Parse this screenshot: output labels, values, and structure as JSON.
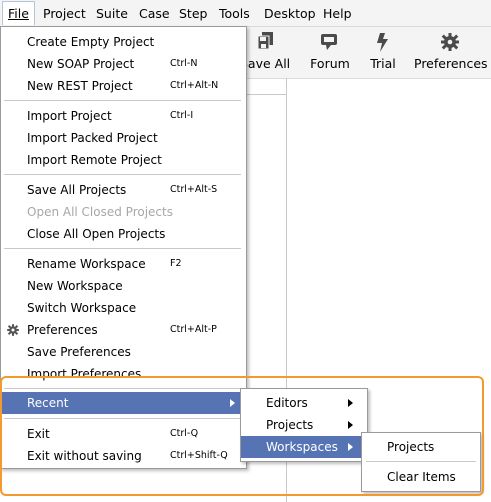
{
  "menubar": {
    "items": [
      {
        "label": "File",
        "mnemonic": "F"
      },
      {
        "label": "Project"
      },
      {
        "label": "Suite"
      },
      {
        "label": "Case"
      },
      {
        "label": "Step"
      },
      {
        "label": "Tools",
        "mnemonic": "T"
      },
      {
        "label": "Desktop",
        "mnemonic": "D"
      },
      {
        "label": "Help",
        "mnemonic": "H"
      }
    ]
  },
  "toolbar": {
    "buttons": [
      {
        "label": "Save All",
        "icon": "save-all-icon"
      },
      {
        "label": "Forum",
        "icon": "forum-icon"
      },
      {
        "label": "Trial",
        "icon": "trial-icon"
      },
      {
        "label": "Preferences",
        "icon": "gear-icon"
      }
    ]
  },
  "file_menu": {
    "items": [
      {
        "label": "Create Empty Project",
        "shortcut": ""
      },
      {
        "label": "New SOAP Project",
        "shortcut": "Ctrl-N"
      },
      {
        "label": "New REST Project",
        "shortcut": "Ctrl+Alt-N"
      },
      {
        "label": "Import Project",
        "shortcut": "Ctrl-I"
      },
      {
        "label": "Import Packed Project",
        "shortcut": ""
      },
      {
        "label": "Import Remote Project",
        "shortcut": ""
      },
      {
        "label": "Save All Projects",
        "shortcut": "Ctrl+Alt-S"
      },
      {
        "label": "Open All Closed Projects",
        "shortcut": "",
        "disabled": true
      },
      {
        "label": "Close All Open Projects",
        "shortcut": ""
      },
      {
        "label": "Rename Workspace",
        "shortcut": "F2"
      },
      {
        "label": "New Workspace",
        "shortcut": ""
      },
      {
        "label": "Switch Workspace",
        "shortcut": ""
      },
      {
        "label": "Preferences",
        "shortcut": "Ctrl+Alt-P",
        "icon": "gear-icon"
      },
      {
        "label": "Save Preferences",
        "shortcut": ""
      },
      {
        "label": "Import Preferences",
        "shortcut": ""
      },
      {
        "label": "Recent",
        "shortcut": "",
        "submenu": true,
        "selected": true
      },
      {
        "label": "Exit",
        "shortcut": "Ctrl-Q"
      },
      {
        "label": "Exit without saving",
        "shortcut": "Ctrl+Shift-Q"
      }
    ]
  },
  "recent_submenu": {
    "items": [
      {
        "label": "Editors",
        "submenu": true
      },
      {
        "label": "Projects",
        "submenu": true
      },
      {
        "label": "Workspaces",
        "submenu": true,
        "selected": true
      }
    ]
  },
  "workspaces_submenu": {
    "items": [
      {
        "label": "Projects"
      },
      {
        "label": "Clear Items"
      }
    ]
  },
  "colors": {
    "selection": "#5673b4",
    "highlight_border": "#f39a2e",
    "disabled_text": "#a7a7a7"
  }
}
